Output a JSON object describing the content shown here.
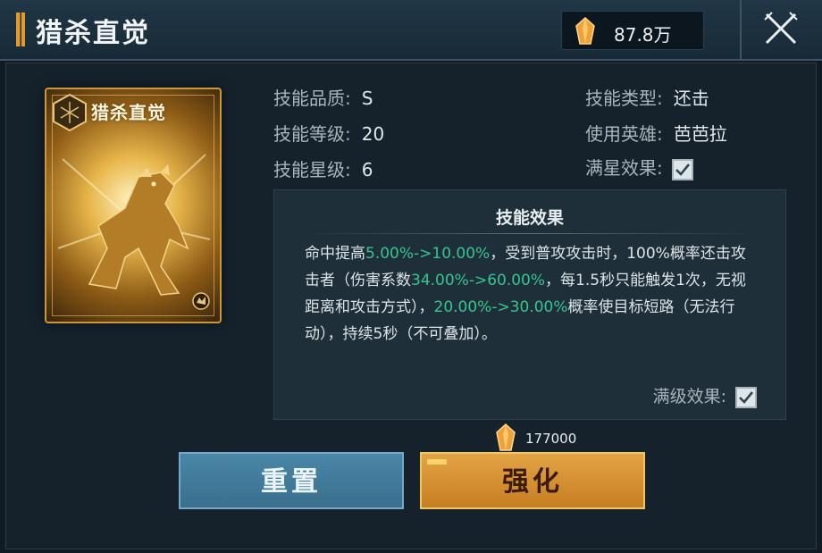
{
  "header": {
    "title": "猎杀直觉",
    "currency_value": "87.8万"
  },
  "card": {
    "name": "猎杀直觉"
  },
  "stats": {
    "quality_label": "技能品质:",
    "quality_value": "S",
    "level_label": "技能等级:",
    "level_value": "20",
    "star_label": "技能星级:",
    "star_value": "6",
    "type_label": "技能类型:",
    "type_value": "还击",
    "hero_label": "使用英雄:",
    "hero_value": "芭芭拉",
    "max_star_label": "满星效果:"
  },
  "effect": {
    "title": "技能效果",
    "seg1": "命中提高",
    "hl1": "5.00%->10.00%",
    "seg2": "，受到普攻攻击时，100%概率还击攻击者（伤害系数",
    "hl2": "34.00%->60.00%",
    "seg3": "，每1.5秒只能触发1次，无视距离和攻击方式），",
    "hl3": "20.00%->30.00%",
    "seg4": "概率使目标短路（无法行动），持续5秒（不可叠加）。",
    "max_level_label": "满级效果:"
  },
  "cost": {
    "value": "177000"
  },
  "buttons": {
    "reset": "重置",
    "upgrade": "强化"
  },
  "colors": {
    "highlight": "#35c58f",
    "gold": "#e29a2d",
    "reset_button": "#4a86a7",
    "upgrade_button": "#e3a445"
  },
  "icons": {
    "currency": "gold-crystal-icon",
    "close": "crossed-swords-close-icon",
    "card_emblem": "hexagon-emblem-icon",
    "checkbox": "check-icon"
  }
}
